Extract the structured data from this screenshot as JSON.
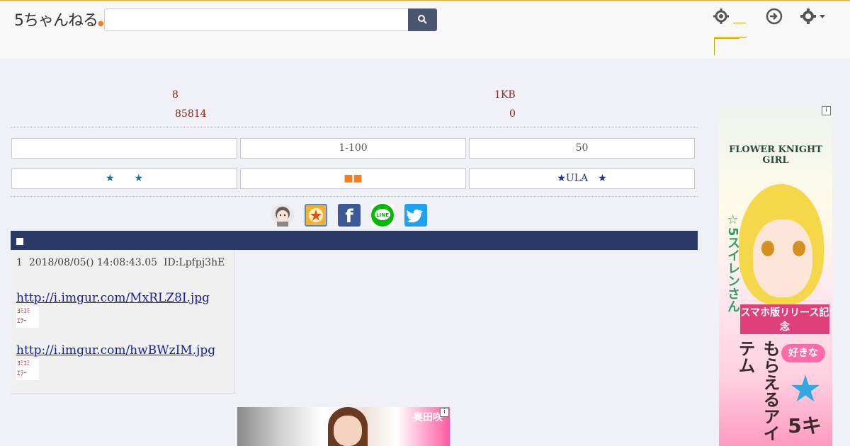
{
  "header": {
    "logo_text": "5ちゃんねる",
    "search_placeholder": "",
    "search_icon": "search-icon",
    "icons": [
      "gear-icon",
      "login-icon",
      "settings-icon"
    ]
  },
  "thread_info": {
    "stat_a": "8",
    "stat_b": "1KB",
    "stat_c": "85814",
    "stat_d": "0"
  },
  "nav_buttons": {
    "row1": [
      "",
      "1-100",
      "50"
    ],
    "row2": [
      "★　　★",
      "■■",
      "★ULA　★"
    ]
  },
  "share_icons": [
    "avatar-icon",
    "bookmark-icon",
    "facebook-icon",
    "line-icon",
    "twitter-icon"
  ],
  "title_bar": {
    "marker": "■"
  },
  "post": {
    "number": "1",
    "date": "2018/08/05() 14:08:43.05",
    "id": "ID:Lpfpj3hE",
    "links": [
      "http://i.imgur.com/MxRLZ8I.jpg",
      "http://i.imgur.com/hwBWzIM.jpg"
    ],
    "image_error_line1": "ﾖﾐｺﾐ",
    "image_error_line2": "ｴﾗｰ"
  },
  "ads": {
    "bottom_name": "奥田咲",
    "side_logo": "FLOWER KNIGHT GIRL",
    "side_vertical": "☆5スイレンさん",
    "side_banner": "スマホ版リリース記念",
    "side_big": "もらえるアイテム",
    "side_pill": "好きな",
    "side_num": "5キ",
    "badge": "i"
  }
}
